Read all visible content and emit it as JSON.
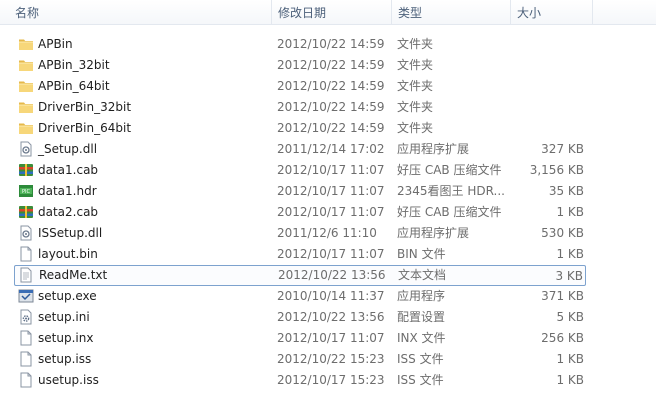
{
  "columns": {
    "name": "名称",
    "date": "修改日期",
    "type": "类型",
    "size": "大小"
  },
  "files": [
    {
      "name": "APBin",
      "date": "2012/10/22 14:59",
      "type": "文件夹",
      "size": "",
      "icon": "folder-icon"
    },
    {
      "name": "APBin_32bit",
      "date": "2012/10/22 14:59",
      "type": "文件夹",
      "size": "",
      "icon": "folder-icon"
    },
    {
      "name": "APBin_64bit",
      "date": "2012/10/22 14:59",
      "type": "文件夹",
      "size": "",
      "icon": "folder-icon"
    },
    {
      "name": "DriverBin_32bit",
      "date": "2012/10/22 14:59",
      "type": "文件夹",
      "size": "",
      "icon": "folder-icon"
    },
    {
      "name": "DriverBin_64bit",
      "date": "2012/10/22 14:59",
      "type": "文件夹",
      "size": "",
      "icon": "folder-icon"
    },
    {
      "name": "_Setup.dll",
      "date": "2011/12/14 17:02",
      "type": "应用程序扩展",
      "size": "327 KB",
      "icon": "dll-icon"
    },
    {
      "name": "data1.cab",
      "date": "2012/10/17 11:07",
      "type": "好压 CAB 压缩文件",
      "size": "3,156 KB",
      "icon": "archive-icon"
    },
    {
      "name": "data1.hdr",
      "date": "2012/10/17 11:07",
      "type": "2345看图王 HDR...",
      "size": "35 KB",
      "icon": "image-icon"
    },
    {
      "name": "data2.cab",
      "date": "2012/10/17 11:07",
      "type": "好压 CAB 压缩文件",
      "size": "1 KB",
      "icon": "archive-icon"
    },
    {
      "name": "ISSetup.dll",
      "date": "2011/12/6 11:10",
      "type": "应用程序扩展",
      "size": "530 KB",
      "icon": "dll-icon"
    },
    {
      "name": "layout.bin",
      "date": "2012/10/17 11:07",
      "type": "BIN 文件",
      "size": "1 KB",
      "icon": "file-icon"
    },
    {
      "name": "ReadMe.txt",
      "date": "2012/10/22 13:56",
      "type": "文本文档",
      "size": "3 KB",
      "icon": "text-file-icon",
      "focused": true
    },
    {
      "name": "setup.exe",
      "date": "2010/10/14 11:37",
      "type": "应用程序",
      "size": "371 KB",
      "icon": "exe-icon"
    },
    {
      "name": "setup.ini",
      "date": "2012/10/22 13:56",
      "type": "配置设置",
      "size": "5 KB",
      "icon": "ini-icon"
    },
    {
      "name": "setup.inx",
      "date": "2012/10/17 11:07",
      "type": "INX 文件",
      "size": "256 KB",
      "icon": "file-icon"
    },
    {
      "name": "setup.iss",
      "date": "2012/10/22 15:23",
      "type": "ISS 文件",
      "size": "1 KB",
      "icon": "file-icon"
    },
    {
      "name": "usetup.iss",
      "date": "2012/10/17 15:23",
      "type": "ISS 文件",
      "size": "1 KB",
      "icon": "file-icon"
    }
  ]
}
